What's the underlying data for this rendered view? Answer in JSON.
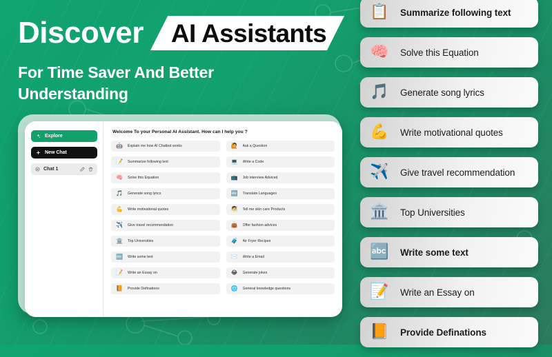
{
  "hero": {
    "title_plain": "Discover",
    "title_banner": "AI Assistants",
    "subtitle": "For Time Saver And Better Understanding",
    "accent_green": "#0fa470",
    "banner_bg": "#ffffff",
    "banner_text_color": "#0d0d0d"
  },
  "app": {
    "sidebar": {
      "explore_label": "Explore",
      "explore_icon": "sparkle-icon",
      "explore_color": "#14a06b",
      "new_chat_label": "New Chat",
      "new_chat_icon": "plus-icon",
      "new_chat_color": "#111111",
      "chat_label": "Chat 1",
      "chat_icon": "chat-bubble-icon",
      "edit_icon": "pencil-icon",
      "delete_icon": "trash-icon"
    },
    "main": {
      "welcome": "Welcome To your Personal AI Assistant. How can I help you ?",
      "suggestions": [
        {
          "label": "Explain me how AI Chatbot works",
          "emoji": "🤖",
          "icon": "robot-icon"
        },
        {
          "label": "Ask a Question",
          "emoji": "🙋",
          "icon": "person-raising-hand-icon"
        },
        {
          "label": "Summarize following text",
          "emoji": "📝",
          "icon": "memo-icon"
        },
        {
          "label": "Write a Code",
          "emoji": "💻",
          "icon": "laptop-code-icon"
        },
        {
          "label": "Solve this Equation",
          "emoji": "🧠",
          "icon": "head-thinking-icon"
        },
        {
          "label": "Job interview Adviced",
          "emoji": "📺",
          "icon": "screen-icon"
        },
        {
          "label": "Generate song lyrics",
          "emoji": "🎵",
          "icon": "music-note-icon"
        },
        {
          "label": "Translate Languages",
          "emoji": "🔤",
          "icon": "translate-icon"
        },
        {
          "label": "Write motivational quotes",
          "emoji": "💪",
          "icon": "flexed-biceps-icon"
        },
        {
          "label": "Tell me skin care Products",
          "emoji": "🧖",
          "icon": "face-care-icon"
        },
        {
          "label": "Give travel recommendation",
          "emoji": "✈️",
          "icon": "airplane-icon"
        },
        {
          "label": "Offer fashion advices",
          "emoji": "👜",
          "icon": "handbag-icon"
        },
        {
          "label": "Top Universities",
          "emoji": "🏛️",
          "icon": "classical-building-icon"
        },
        {
          "label": "Air Fryer Recipes",
          "emoji": "🧳",
          "icon": "appliance-icon"
        },
        {
          "label": "Write some text",
          "emoji": "🔤",
          "icon": "input-letters-icon"
        },
        {
          "label": "Write a Email",
          "emoji": "✉️",
          "icon": "envelope-icon"
        },
        {
          "label": "Write an Essay on",
          "emoji": "📝",
          "icon": "pencil-paper-icon"
        },
        {
          "label": "Generate jokes",
          "emoji": "😂",
          "icon": "laughing-face-icon"
        },
        {
          "label": "Provide Definations",
          "emoji": "📙",
          "icon": "book-icon"
        },
        {
          "label": "General knowledge questions",
          "emoji": "🌐",
          "icon": "globe-icon"
        }
      ]
    }
  },
  "right_panel": {
    "cards": [
      {
        "label": "Summarize following text",
        "emoji": "📋",
        "icon": "memo-icon",
        "bold": true
      },
      {
        "label": "Solve this Equation",
        "emoji": "🧠",
        "icon": "head-thinking-icon",
        "bold": false
      },
      {
        "label": "Generate song lyrics",
        "emoji": "🎵",
        "icon": "music-note-icon",
        "bold": false
      },
      {
        "label": "Write motivational quotes",
        "emoji": "💪",
        "icon": "flexed-biceps-icon",
        "bold": false
      },
      {
        "label": "Give travel recommendation",
        "emoji": "✈️",
        "icon": "airplane-icon",
        "bold": false
      },
      {
        "label": "Top Universities",
        "emoji": "🏛️",
        "icon": "classical-building-icon",
        "bold": false
      },
      {
        "label": "Write some text",
        "emoji": "🔤",
        "icon": "input-letters-icon",
        "bold": true
      },
      {
        "label": "Write an Essay on",
        "emoji": "📝",
        "icon": "pencil-paper-icon",
        "bold": false
      },
      {
        "label": "Provide Definations",
        "emoji": "📙",
        "icon": "book-icon",
        "bold": true
      }
    ]
  }
}
